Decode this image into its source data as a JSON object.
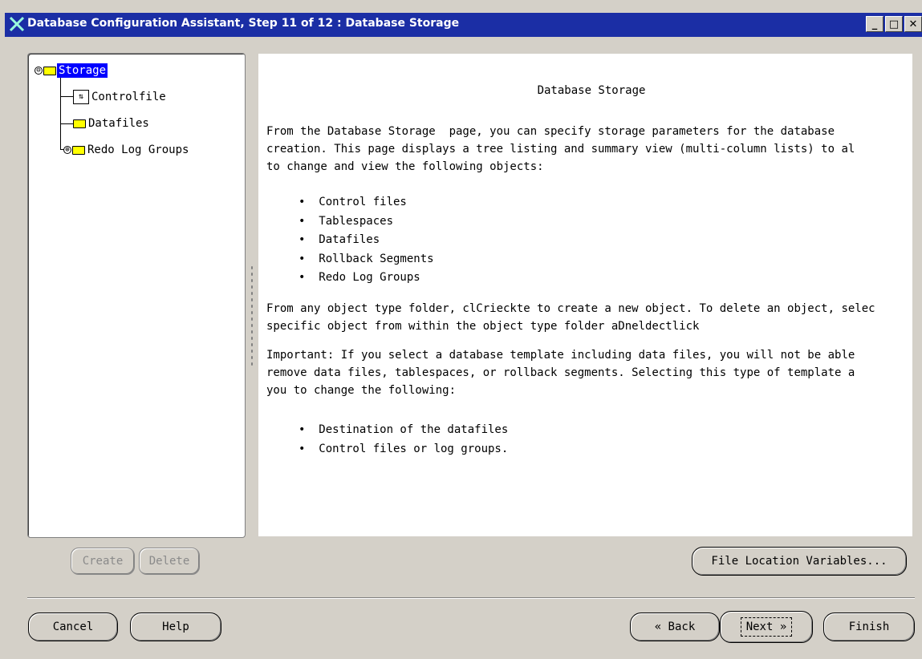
{
  "window": {
    "title": "Database Configuration Assistant, Step 11 of 12 : Database Storage",
    "controls": {
      "minimize": "_",
      "maximize": "□",
      "close": "✕"
    }
  },
  "tree": {
    "root": {
      "label": "Storage",
      "expander": "⊖"
    },
    "items": [
      {
        "label": "Controlfile",
        "icon": "controlfile-icon"
      },
      {
        "label": "Datafiles",
        "icon": "folder-icon"
      },
      {
        "label": "Redo Log Groups",
        "icon": "folder-icon",
        "expander": "⊕"
      }
    ]
  },
  "content": {
    "title": "Database Storage",
    "para1": "From the Database Storage  page, you can specify storage parameters for the database\ncreation. This page displays a tree listing and summary view (multi-column lists) to al\nto change and view the following objects:",
    "bullets1": "•  Control files\n•  Tablespaces\n•  Datafiles\n•  Rollback Segments\n•  Redo Log Groups",
    "para2": "From any object type folder, clCrieckte to create a new object. To delete an object, selec\nspecific object from within the object type folder aDneldectlick",
    "para3": "Important: If you select a database template including data files, you will not be able\nremove data files, tablespaces, or rollback segments. Selecting this type of template a\nyou to change the following:",
    "bullets2": "•  Destination of the datafiles\n•  Control files or log groups."
  },
  "buttons": {
    "create": "Create",
    "delete": "Delete",
    "file_location": "File Location Variables...",
    "cancel": "Cancel",
    "help": "Help",
    "back": "«  Back",
    "next": "Next  »",
    "finish": "Finish"
  },
  "colors": {
    "titlebar": "#1b2ea5",
    "selection": "#0000ff",
    "folder": "#ffff00",
    "background": "#d4d0c8"
  }
}
